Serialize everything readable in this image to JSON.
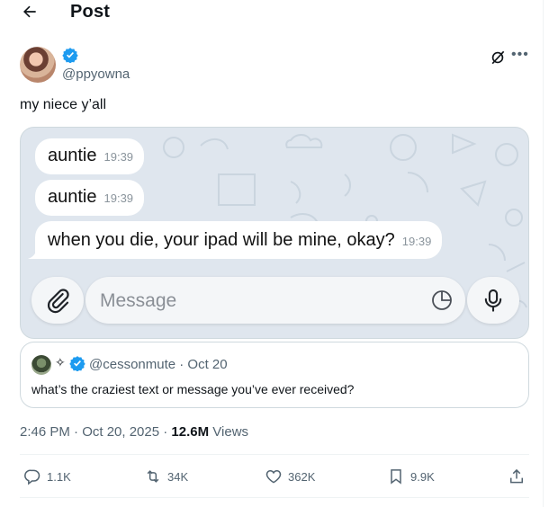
{
  "header": {
    "title": "Post"
  },
  "author": {
    "handle": "@ppyowna",
    "verified": true
  },
  "post": {
    "text": "my niece y’all"
  },
  "media": {
    "messages": [
      {
        "text": "auntie",
        "time": "19:39"
      },
      {
        "text": "auntie",
        "time": "19:39"
      },
      {
        "text": "when you die, your ipad will be mine, okay?",
        "time": "19:39"
      }
    ],
    "input_placeholder": "Message"
  },
  "quote": {
    "handle": "@cessonmute",
    "date": "Oct 20",
    "meta": "@cessonmute · Oct 20",
    "sparkle": "✧",
    "text": "what’s the craziest text or message you’ve ever received?"
  },
  "timestamp": {
    "time_date": "2:46 PM · Oct 20, 2025 · ",
    "views": "12.6M",
    "views_label": " Views"
  },
  "actions": {
    "replies": "1.1K",
    "reposts": "34K",
    "likes": "362K",
    "bookmarks": "9.9K"
  },
  "colors": {
    "accent": "#1d9bf0",
    "muted": "#536471",
    "text": "#0f1419"
  }
}
